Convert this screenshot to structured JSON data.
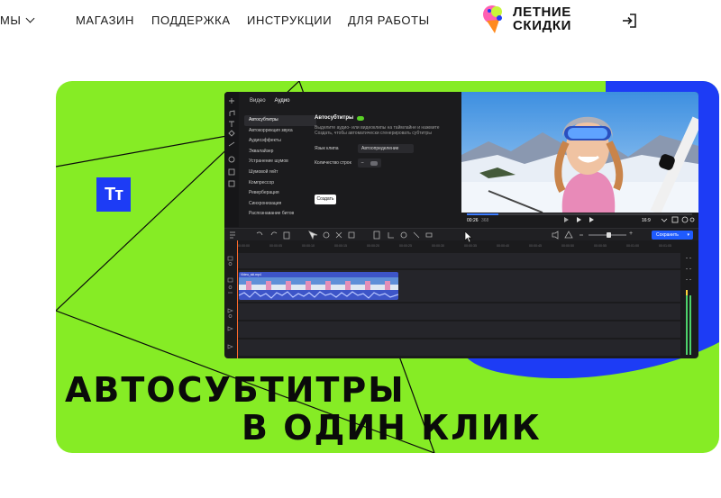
{
  "nav": {
    "first_label": "МЫ",
    "items": [
      "МАГАЗИН",
      "ПОДДЕРЖКА",
      "ИНСТРУКЦИИ",
      "ДЛЯ РАБОТЫ"
    ],
    "promo_line1": "ЛЕТНИЕ",
    "promo_line2": "СКИДКИ"
  },
  "banner": {
    "logo_text": "Тт",
    "headline_line1": "АВТОСУБТИТРЫ",
    "headline_line2": "В ОДИН КЛИК",
    "colors": {
      "background": "#86ec25",
      "accent": "#1d3cf5"
    }
  },
  "editor": {
    "tabs": [
      "Видео",
      "Аудио"
    ],
    "menu": [
      "Автосубтитры",
      "Автокоррекция звука",
      "Аудиоэффекты",
      "Эквалайзер",
      "Устранение шумов",
      "Шумовой гейт",
      "Компрессор",
      "Реверберация",
      "Синхронизация",
      "Распознавание битов"
    ],
    "selected_menu": "Автосубтитры",
    "panel": {
      "title": "Автосубтитры",
      "description": "Выделите аудио- или видеоклипы на таймлайне и нажмите Создать, чтобы автоматически сгенерировать субтитры",
      "language_label": "Язык клипа",
      "language_value": "Автоопределение",
      "lines_label": "Количество строк",
      "create_label": "Создать"
    },
    "preview": {
      "timecode": "00:26",
      "timecode_total": "368",
      "aspect": "16:9"
    },
    "save_label": "Сохранить",
    "ruler_ticks": [
      "00:00:00",
      "00:00:05",
      "00:00:10",
      "00:00:15",
      "00:00:20",
      "00:00:25",
      "00:00:30",
      "00:00:35",
      "00:00:40",
      "00:00:45",
      "00:00:50",
      "00:00:55",
      "00:01:00",
      "00:01:05"
    ],
    "clip_label": "Video_ski.mp4"
  }
}
